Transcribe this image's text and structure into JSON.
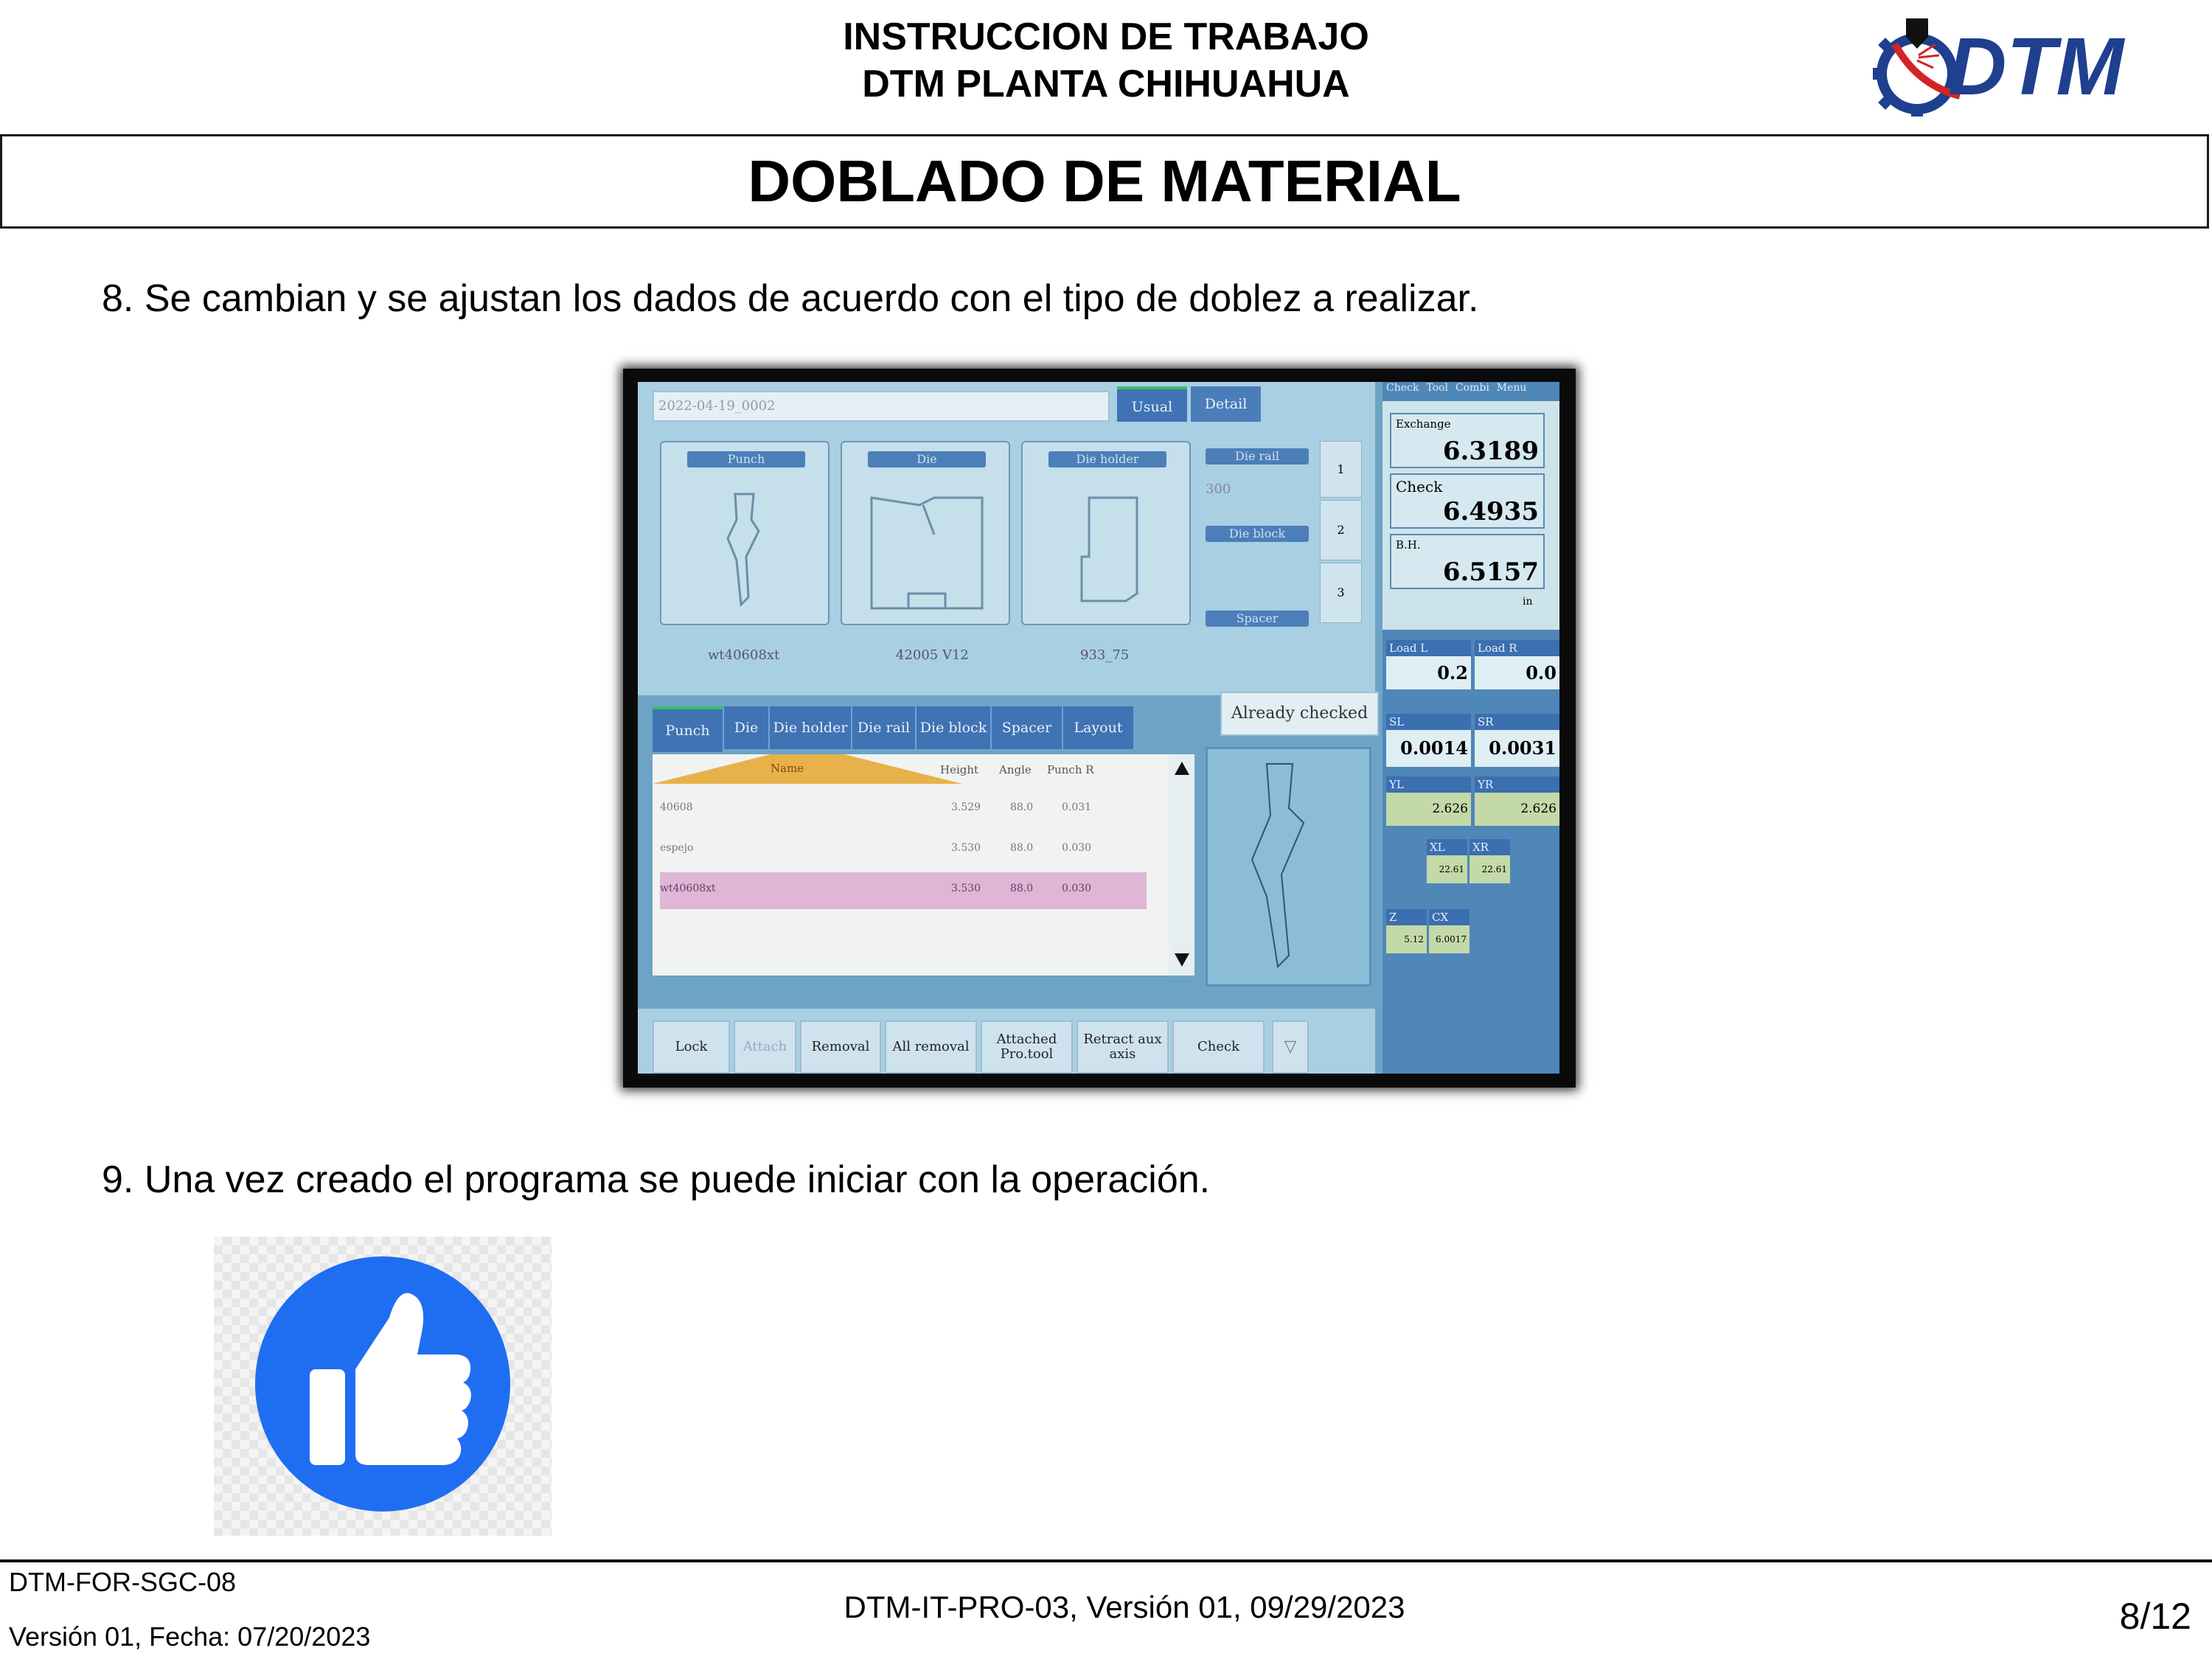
{
  "header": {
    "line1": "INSTRUCCION DE TRABAJO",
    "line2": "DTM PLANTA CHIHUAHUA",
    "logo_text": "DTM",
    "title": "DOBLADO DE MATERIAL"
  },
  "steps": [
    "8. Se cambian y se ajustan los dados de acuerdo con el tipo de doblez a realizar.",
    "9. Una vez creado el programa se puede iniciar con la operación."
  ],
  "screen": {
    "program_name": "2022-04-19_0002",
    "view_tabs": [
      "Usual",
      "Detail"
    ],
    "top_menu": [
      "Check",
      "Tool",
      "Combi",
      "Menu"
    ],
    "tool_boxes": [
      {
        "label": "Punch",
        "name": "wt40608xt"
      },
      {
        "label": "Die",
        "name": "42005 V12"
      },
      {
        "label": "Die holder",
        "name": "933_75"
      }
    ],
    "side_labels": {
      "die_rail": "Die rail",
      "die_rail_value": "300",
      "die_block": "Die block",
      "spacer": "Spacer"
    },
    "stations": [
      "1",
      "2",
      "3"
    ],
    "readouts": [
      {
        "label": "Exchange",
        "value": "6.3189"
      },
      {
        "label": "Check",
        "value": "6.4935"
      },
      {
        "label": "B.H.",
        "value": "6.5157"
      }
    ],
    "unit": "in",
    "tool_tabs": [
      "Punch",
      "Die",
      "Die holder",
      "Die rail",
      "Die block",
      "Spacer",
      "Layout"
    ],
    "already_checked": "Already checked",
    "table": {
      "headers": [
        "Name",
        "Height",
        "Angle",
        "Punch R"
      ],
      "rows": [
        {
          "name": "40608",
          "height": "3.529",
          "angle": "88.0",
          "punch_r": "0.031"
        },
        {
          "name": "espejo",
          "height": "3.530",
          "angle": "88.0",
          "punch_r": "0.030"
        },
        {
          "name": "wt40608xt",
          "height": "3.530",
          "angle": "88.0",
          "punch_r": "0.030"
        }
      ]
    },
    "load": {
      "load_l_label": "Load L",
      "load_r_label": "Load R",
      "load_l": "0.2",
      "load_r": "0.0"
    },
    "sl_sr": {
      "sl_label": "SL",
      "sr_label": "SR",
      "sl": "0.0014",
      "sr": "0.0031"
    },
    "yl_yr": {
      "yl_label": "YL",
      "yr_label": "YR",
      "yl": "2.626",
      "yr": "2.626"
    },
    "xl_xr": {
      "xl_label": "XL",
      "xr_label": "XR",
      "xl": "22.61",
      "xr": "22.61"
    },
    "z_cx": {
      "z_label": "Z",
      "cx_label": "CX",
      "z": "5.12",
      "cx": "6.0017"
    },
    "bottom_buttons": [
      "Lock",
      "Attach",
      "Removal",
      "All removal",
      "Attached Pro.tool",
      "Retract aux axis",
      "Check"
    ]
  },
  "footer": {
    "form_code": "DTM-FOR-SGC-08",
    "form_version": "Versión 01, Fecha: 07/20/2023",
    "doc_ref": "DTM-IT-PRO-03, Versión 01, 09/29/2023",
    "page": "8/12"
  }
}
